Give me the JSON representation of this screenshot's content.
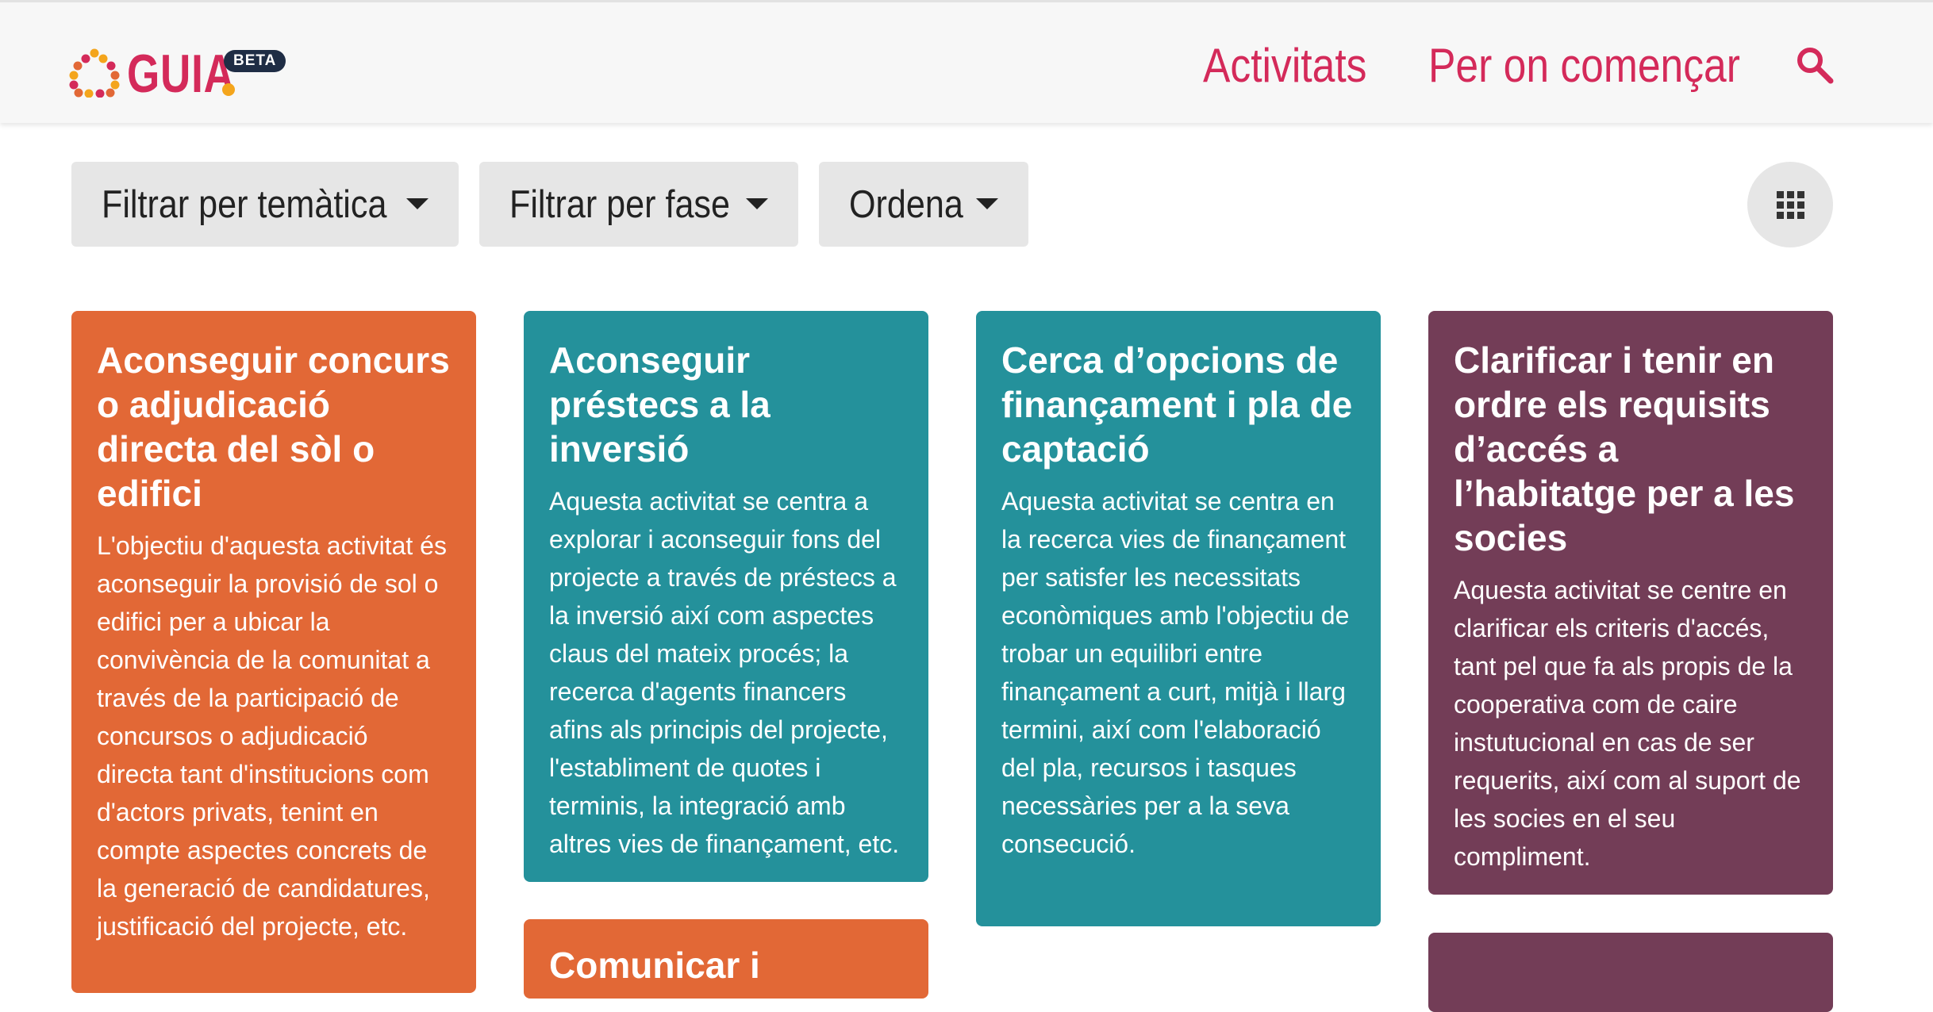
{
  "header": {
    "logo_text": "GUIA",
    "beta_badge": "BETA",
    "nav": [
      {
        "label": "Activitats"
      },
      {
        "label": "Per on començar"
      }
    ],
    "search_icon": "search-icon"
  },
  "filters": [
    {
      "label": "Filtrar per temàtica"
    },
    {
      "label": "Filtrar per fase"
    },
    {
      "label": "Ordena"
    }
  ],
  "view_toggle_icon": "grid-icon",
  "colors": {
    "brand": "#d42a5a",
    "orange": "#e26836",
    "teal": "#24919b",
    "plum": "#733d57",
    "filter_bg": "#e6e6e6"
  },
  "cards": [
    {
      "title": "Aconseguir concurs o adjudicació directa del sòl o edifici",
      "description": "L'objectiu d'aquesta activitat és aconseguir la provisió de sol o edifici per a ubicar la convivència de la comunitat a través de la participació de concursos o adjudicació directa tant d'institucions com d'actors privats, tenint en compte aspectes concrets de la generació de candidatures, justificació del projecte, etc."
    },
    {
      "title": "Aconseguir préstecs a la inversió",
      "description": "Aquesta activitat se centra a explorar i aconseguir fons del projecte a través de préstecs a la inversió així com aspectes claus del mateix procés; la recerca d'agents financers afins als principis del projecte, l'establiment de quotes i terminis, la integració amb altres vies de finançament, etc."
    },
    {
      "title": "Cerca d’opcions de finançament i pla de captació",
      "description": "Aquesta activitat se centra en la recerca vies de finançament per satisfer les necessitats econòmiques amb l'objectiu de trobar un equilibri entre finançament a curt, mitjà i llarg termini, així com l'elaboració del pla, recursos i tasques necessàries per a la seva consecució."
    },
    {
      "title": "Clarificar i tenir en ordre els requisits d’accés a l’habitatge per a les socies",
      "description": "Aquesta activitat se centre en clarificar els criteris d'accés, tant pel que fa als propis de la cooperativa com de caire instutucional en cas de ser requerits, així com al suport de les socies en el seu compliment."
    },
    {
      "title": "Comunicar i"
    }
  ]
}
